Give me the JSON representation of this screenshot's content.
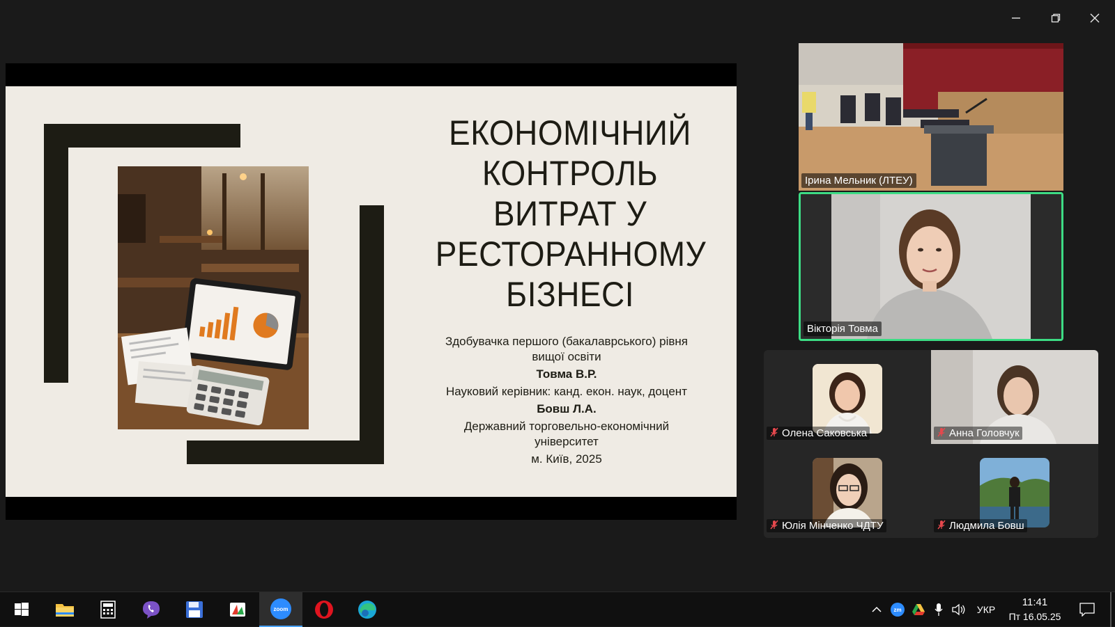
{
  "window": {
    "controls": [
      "minimize-icon",
      "restore-icon",
      "close-icon"
    ]
  },
  "slide": {
    "title": "ЕКОНОМІЧНИЙ КОНТРОЛЬ ВИТРАТ У РЕСТОРАННОМУ БІЗНЕСІ",
    "title_lines": [
      "ЕКОНОМІЧНИЙ",
      "КОНТРОЛЬ",
      "ВИТРАТ У",
      "РЕСТОРАННОМУ",
      "БІЗНЕСІ"
    ],
    "lines": {
      "l1": "Здобувачка першого (бакалаврського) рівня",
      "l2": "вищої освіти",
      "author": "Товма В.Р.",
      "l3": "Науковий керівник: канд. екон. наук, доцент",
      "supervisor": "Бовш Л.А.",
      "l4": "Державний торговельно-економічний",
      "l5": "університет",
      "l6": "м. Київ, 2025"
    }
  },
  "participants": {
    "top": "Ірина Мельник (ЛТЕУ)",
    "speaker": "Вікторія Товма",
    "gallery": [
      {
        "name": "Олена Саковська",
        "muted": true
      },
      {
        "name": "Анна Головчук",
        "muted": true
      },
      {
        "name": "Юлія Мінченко ЧДТУ",
        "muted": true
      },
      {
        "name": "Людмила Бовш",
        "muted": true
      }
    ]
  },
  "taskbar": {
    "apps": [
      "windows-start-icon",
      "file-explorer-icon",
      "calculator-icon",
      "viber-icon",
      "save-icon",
      "presentation-app-icon",
      "zoom-icon",
      "opera-icon",
      "edge-icon"
    ],
    "zoom_label": "zoom",
    "language": "УКР",
    "time": "11:41",
    "date": "Пт 16.05.25"
  },
  "colors": {
    "slide_bg": "#efebe4",
    "slide_dark": "#1d1c14",
    "active_speaker": "#3ddc84",
    "zoom_blue": "#2d8cff",
    "mute_red": "#e5484d"
  }
}
